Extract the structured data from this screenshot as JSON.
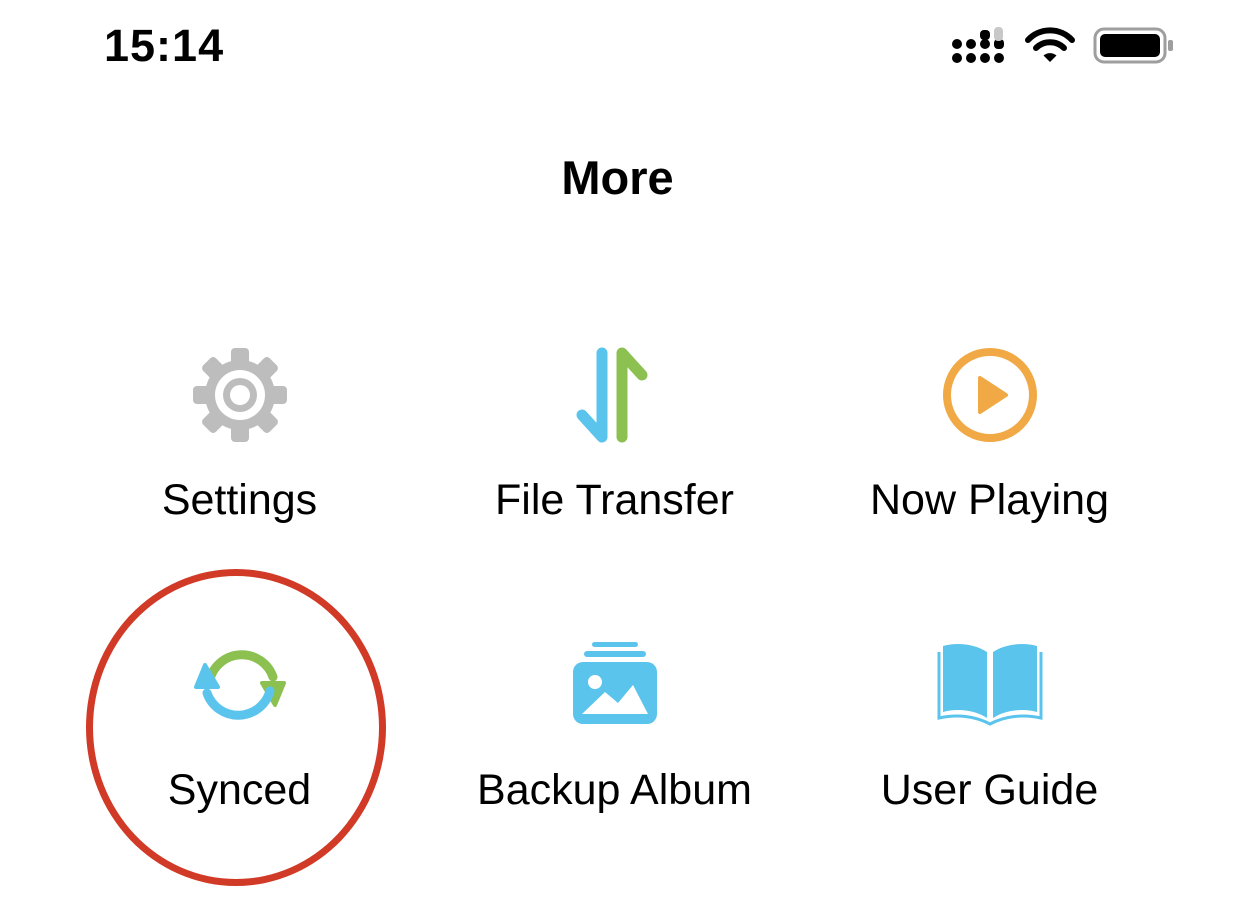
{
  "status_bar": {
    "time": "15:14",
    "icons": [
      "cellular-signal-icon",
      "wifi-icon",
      "battery-icon"
    ]
  },
  "header": {
    "title": "More"
  },
  "menu": {
    "items": [
      {
        "label": "Settings",
        "icon": "gear-icon",
        "color": "#bdbdbd"
      },
      {
        "label": "File Transfer",
        "icon": "transfer-arrows-icon",
        "colors": [
          "#5bc4ec",
          "#8cc152"
        ]
      },
      {
        "label": "Now Playing",
        "icon": "play-circle-icon",
        "color": "#f0a945"
      },
      {
        "label": "Synced",
        "icon": "sync-icon",
        "colors": [
          "#8cc152",
          "#5bc4ec"
        ]
      },
      {
        "label": "Backup Album",
        "icon": "photo-album-icon",
        "color": "#5bc4ec"
      },
      {
        "label": "User Guide",
        "icon": "open-book-icon",
        "color": "#5bc4ec"
      }
    ]
  },
  "annotation": {
    "highlight_color": "#d03a26"
  }
}
